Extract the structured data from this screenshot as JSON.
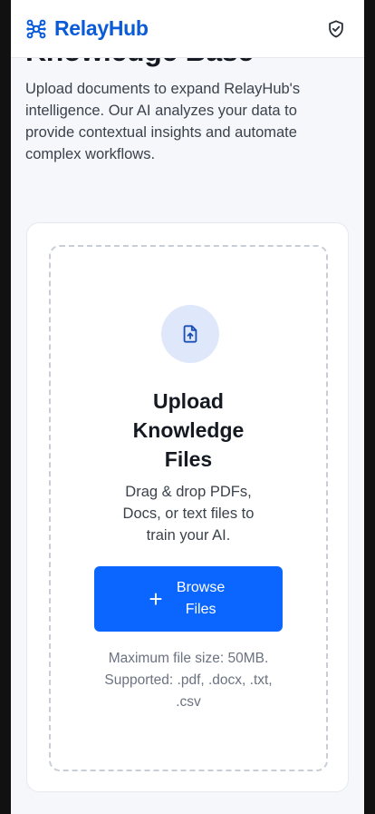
{
  "header": {
    "brand_name": "RelayHub",
    "brand_color": "#0a5bd8",
    "brand_icon": "network-nodes-icon",
    "right_icon": "shield-check-icon"
  },
  "page": {
    "title": "Knowledge Base",
    "intro": "Upload documents to expand RelayHub's intelligence. Our AI analyzes your data to provide contextual insights and automate complex workflows."
  },
  "upload": {
    "icon": "file-upload-icon",
    "title": "Upload Knowledge Files",
    "description": "Drag & drop PDFs, Docs, or text files to train your AI.",
    "button_icon": "plus-icon",
    "button_label": "Browse Files",
    "button_color": "#0a66ff",
    "note": "Maximum file size: 50MB. Supported: .pdf, .docx, .txt, .csv"
  }
}
